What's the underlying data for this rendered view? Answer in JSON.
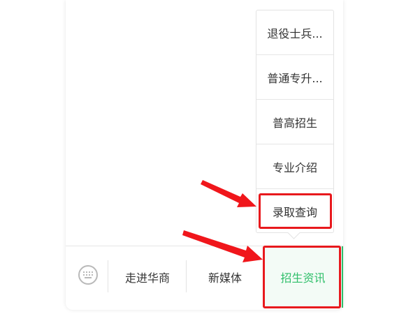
{
  "submenu": {
    "items": [
      {
        "label": "退役士兵..."
      },
      {
        "label": "普通专升..."
      },
      {
        "label": "普高招生"
      },
      {
        "label": "专业介绍"
      },
      {
        "label": "录取查询"
      }
    ]
  },
  "tabbar": {
    "keyboard_icon": "keyboard-icon",
    "tabs": [
      {
        "label": "走进华商"
      },
      {
        "label": "新媒体"
      },
      {
        "label": "招生资讯"
      }
    ]
  },
  "colors": {
    "active_tab_text": "#2fbf6a",
    "active_tab_bg": "#f3fbf6",
    "highlight": "#e8191d",
    "arrow": "#f0161b"
  }
}
